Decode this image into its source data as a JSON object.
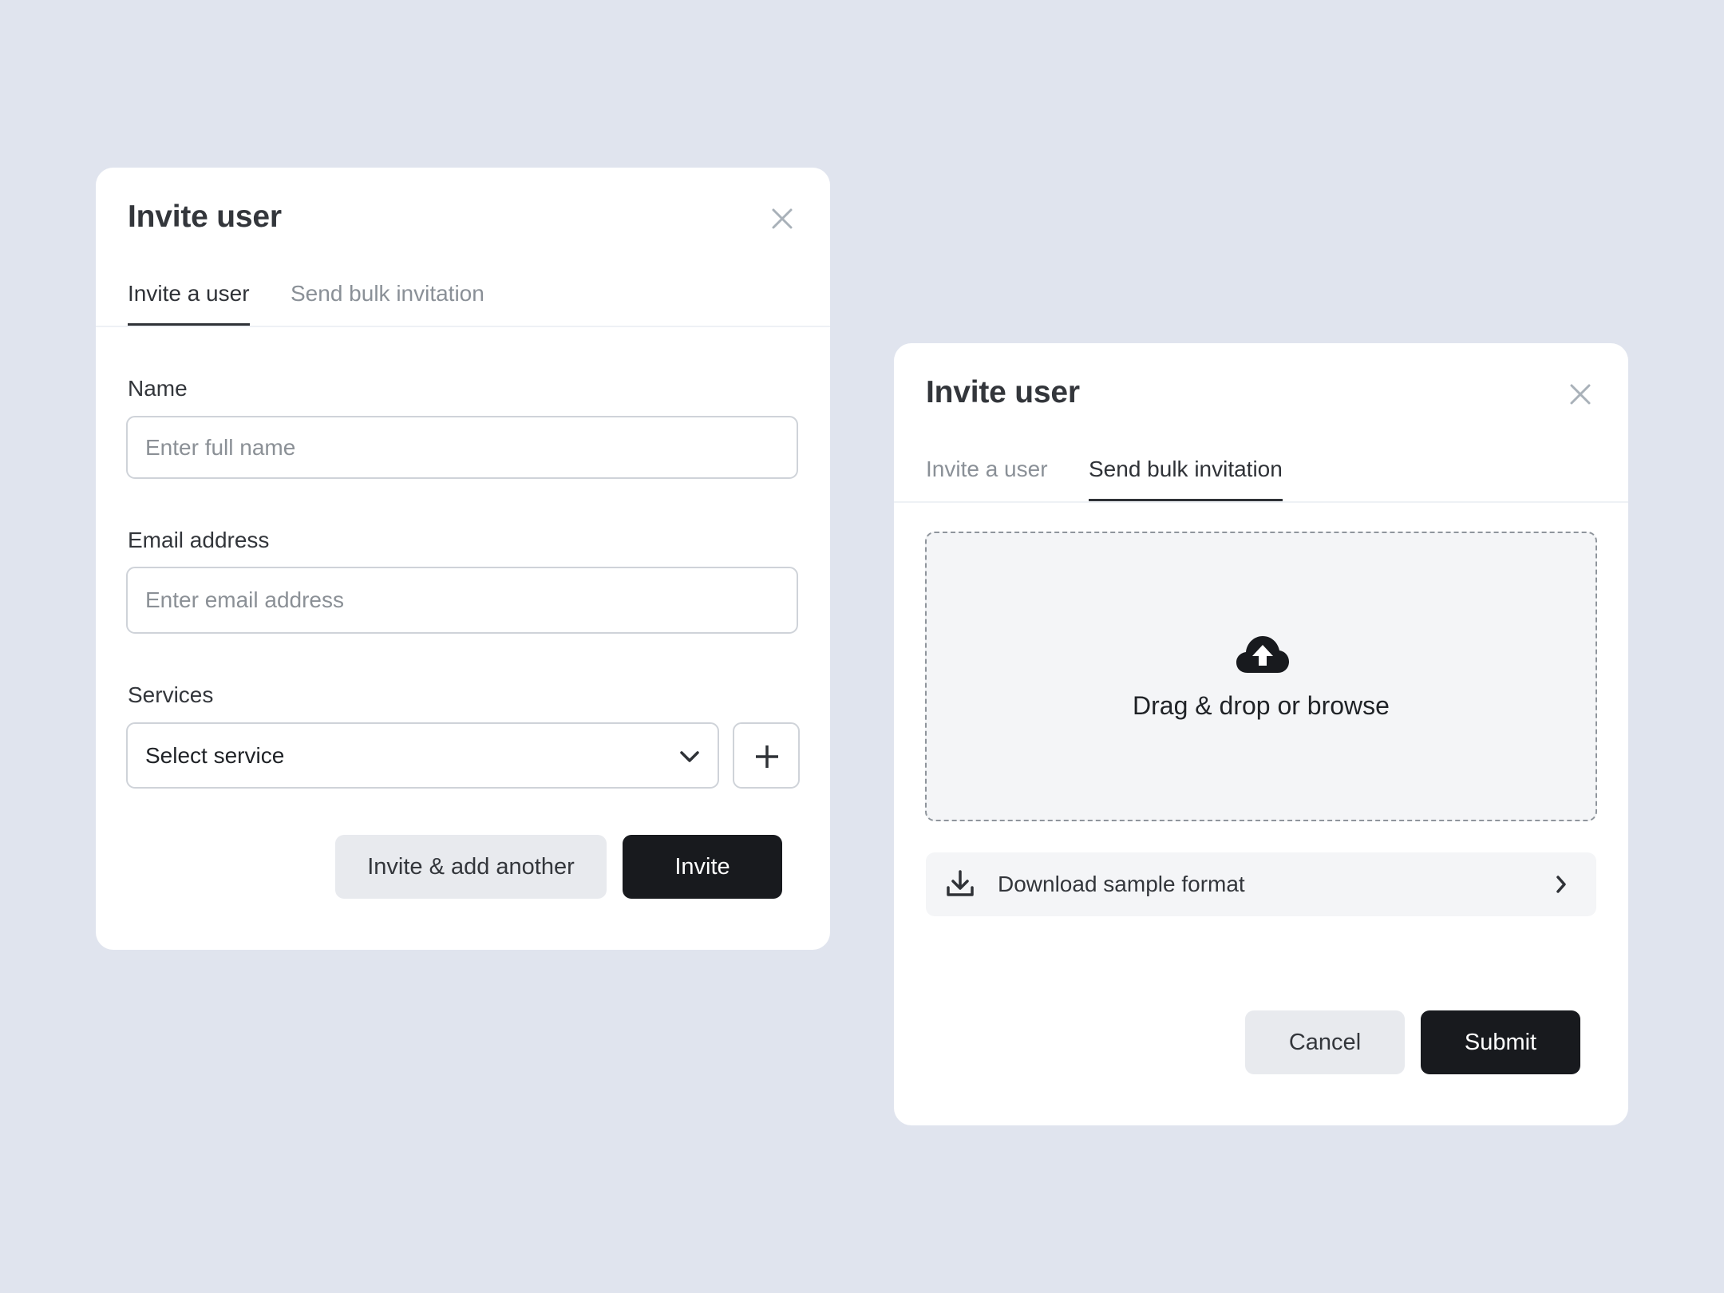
{
  "dialogs": [
    {
      "title": "Invite user",
      "close_icon": "close-icon",
      "tabs": [
        {
          "label": "Invite a user",
          "active": true
        },
        {
          "label": "Send bulk invitation",
          "active": false
        }
      ],
      "fields": {
        "name": {
          "label": "Name",
          "value": "",
          "placeholder": "Enter full name"
        },
        "email": {
          "label": "Email address",
          "value": "",
          "placeholder": "Enter email address"
        },
        "services": {
          "label": "Services",
          "selected": "Select service",
          "icon": "chevron-down-icon",
          "add_icon": "plus-icon"
        }
      },
      "buttons": {
        "secondary": "Invite & add another",
        "primary": "Invite"
      }
    },
    {
      "title": "Invite user",
      "close_icon": "close-icon",
      "tabs": [
        {
          "label": "Invite a user",
          "active": false
        },
        {
          "label": "Send bulk invitation",
          "active": true
        }
      ],
      "dropzone": {
        "icon": "cloud-upload-icon",
        "text": "Drag & drop or browse"
      },
      "download": {
        "icon": "download-icon",
        "label": "Download sample format",
        "chevron": "chevron-right-icon"
      },
      "buttons": {
        "secondary": "Cancel",
        "primary": "Submit"
      }
    }
  ],
  "colors": {
    "background": "#e0e4ee",
    "card": "#ffffff",
    "primary_button": "#181a1e",
    "secondary_button": "#e8eaee",
    "inactive_tab": "#8a9097",
    "dropzone": "#f4f5f7"
  }
}
